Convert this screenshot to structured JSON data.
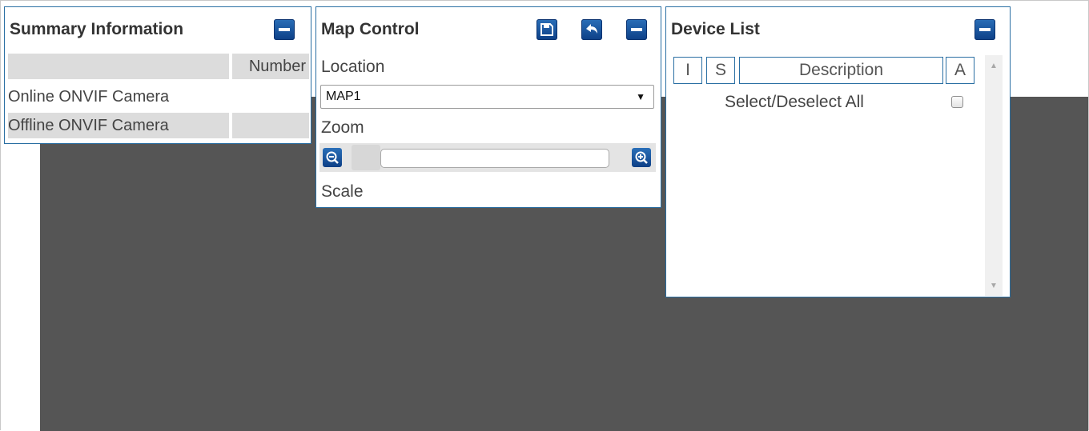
{
  "summary": {
    "title": "Summary Information",
    "column_header": "Number",
    "rows": [
      {
        "label": "Online ONVIF Camera",
        "value": ""
      },
      {
        "label": "Offline ONVIF Camera",
        "value": ""
      }
    ]
  },
  "map_control": {
    "title": "Map Control",
    "location_label": "Location",
    "location_selected": "MAP1",
    "zoom_label": "Zoom",
    "scale_label": "Scale"
  },
  "device_list": {
    "title": "Device List",
    "columns": [
      "I",
      "S",
      "Description",
      "A"
    ],
    "select_all_label": "Select/Deselect All",
    "select_all_checked": false
  },
  "colors": {
    "map_background": "#555555",
    "panel_border": "#2a6fa3",
    "button_blue": "#0d3f86"
  },
  "icons": {
    "collapse": "minus-icon",
    "save": "floppy-disk-icon",
    "back": "undo-arrow-icon",
    "zoom_out": "zoom-out-icon",
    "zoom_in": "zoom-in-icon"
  }
}
